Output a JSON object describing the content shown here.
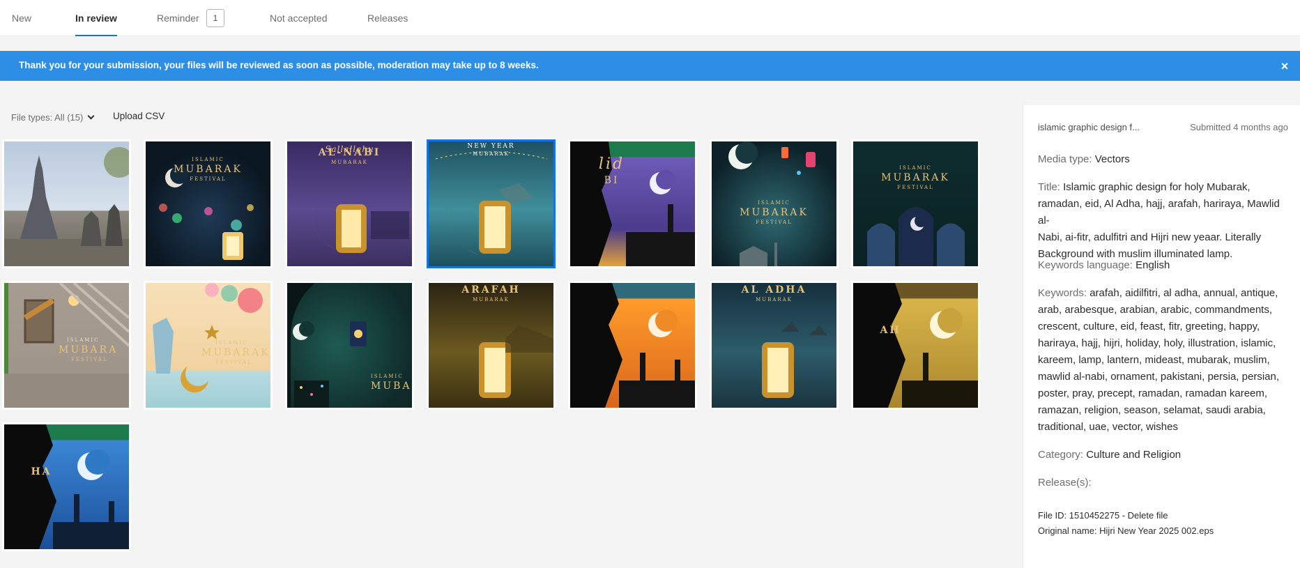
{
  "tabs": [
    {
      "label": "New"
    },
    {
      "label": "In review",
      "active": true
    },
    {
      "label": "Reminder",
      "badge": "1"
    },
    {
      "label": "Not accepted"
    },
    {
      "label": "Releases"
    }
  ],
  "banner": {
    "text": "Thank you for your submission, your files will be reviewed as soon as possible, moderation may take up to 8 weeks.",
    "close": "×",
    "color": "#2d8ee6"
  },
  "toolbar": {
    "filter_label": "File types: All (15)",
    "upload_label": "Upload CSV"
  },
  "thumbnails": [
    {
      "text_top": "",
      "text_main": "",
      "text_sub": ""
    },
    {
      "text_top": "ISLAMIC",
      "text_main": "MUBARAK",
      "text_sub": "FESTIVAL"
    },
    {
      "text_top": "Sallallahu",
      "text_main": "AL-NABI",
      "text_sub": "MUBARAK"
    },
    {
      "text_top": "NEW YEAR",
      "text_main": "",
      "text_sub": "MUBARAK"
    },
    {
      "text_top": "",
      "text_main": "lid",
      "text_sub": "BI"
    },
    {
      "text_top": "ISLAMIC",
      "text_main": "MUBARAK",
      "text_sub": "FESTIVAL"
    },
    {
      "text_top": "ISLAMIC",
      "text_main": "MUBARAK",
      "text_sub": "FESTIVAL"
    },
    {
      "text_top": "ISLAMIC",
      "text_main": "MUBARA",
      "text_sub": "FESTIVAL"
    },
    {
      "text_top": "ISLAMIC",
      "text_main": "MUBARAK",
      "text_sub": "FESTIVAL"
    },
    {
      "text_top": "ISLAMIC",
      "text_main": "MUBA",
      "text_sub": ""
    },
    {
      "text_top": "ARAFAH",
      "text_main": "",
      "text_sub": "MUBARAK"
    },
    {
      "text_top": "",
      "text_main": "",
      "text_sub": ""
    },
    {
      "text_top": "AL ADHA",
      "text_main": "",
      "text_sub": "MUBARAK"
    },
    {
      "text_top": "",
      "text_main": "AH",
      "text_sub": ""
    },
    {
      "text_top": "",
      "text_main": "HA",
      "text_sub": ""
    }
  ],
  "details": {
    "short_title": "islamic graphic design f...",
    "submitted": "Submitted 4 months ago",
    "media_type_label": "Media type:",
    "media_type": "Vectors",
    "title_label": "Title:",
    "title_line1": "Islamic graphic design for holy Mubarak,",
    "title_line2": "ramadan, eid, Al Adha, hajj, arafah, hariraya, Mawlid al-",
    "title_line3": "Nabi, ai-fitr, adulfitri and Hijri new yeaar. Literally",
    "title_line4": "Background with muslim illuminated lamp.",
    "keywords_language_label": "Keywords language:",
    "keywords_language": "English",
    "keywords_label": "Keywords:",
    "keywords_line1": "arafah, aidilfitri, al adha, annual, antique,",
    "keywords_line2": "arab, arabesque, arabian, arabic, commandments,",
    "keywords_line3": "crescent, culture, eid, feast, fitr, greeting, happy,",
    "keywords_line4": "hariraya, hajj, hijri, holiday, holy, illustration, islamic,",
    "keywords_line5": "kareem, lamp, lantern, mideast, mubarak, muslim,",
    "keywords_line6": "mawlid al-nabi, ornament, pakistani, persia, persian,",
    "keywords_line7": "poster, pray, precept, ramadan, ramadan kareem,",
    "keywords_line8": "ramazan, religion, season, selamat, saudi arabia,",
    "keywords_line9": "traditional, uae, vector, wishes",
    "category_label": "Category:",
    "category": "Culture and Religion",
    "releases_label": "Release(s):",
    "file_id_text": "File ID: 1510452275 - ",
    "delete_label": "Delete file",
    "original_name": "Original name: Hijri New Year 2025 002.eps"
  }
}
